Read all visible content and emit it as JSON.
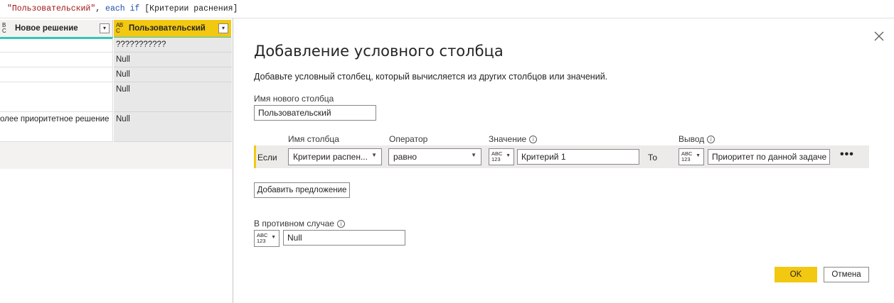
{
  "formula": {
    "str_part": "\"Пользовательский\"",
    "sep": ", ",
    "kw_each": "each",
    "space": " ",
    "kw_if": "if",
    "ref": " [Критерии раснения]"
  },
  "grid": {
    "columns": [
      {
        "type_top": "B",
        "type_bottom": "C",
        "type_prefix": "A",
        "label": "Новое решение"
      },
      {
        "type_top": "B",
        "type_bottom": "C",
        "type_prefix": "A",
        "label": "Пользовательский"
      }
    ],
    "rows": [
      {
        "c1": "",
        "c2": "???????????"
      },
      {
        "c1": "",
        "c2": "Null"
      },
      {
        "c1": "",
        "c2": "Null"
      },
      {
        "c1": "",
        "c2": "Null"
      },
      {
        "c1": "олее приоритетное решение",
        "c2": "Null"
      }
    ]
  },
  "dialog": {
    "title": "Добавление условного столбца",
    "subtitle": "Добавьте условный столбец, который вычисляется из других столбцов или значений.",
    "new_col_label": "Имя нового столбца",
    "new_col_value": "Пользовательский",
    "headers": {
      "column_name": "Имя столбца",
      "operator": "Оператор",
      "value": "Значение",
      "output": "Вывод"
    },
    "rule": {
      "if_label": "Если",
      "column": "Критерии распен...",
      "operator": "равно",
      "value_type": "ABC 123",
      "value": "Критерий 1",
      "then_label": "То",
      "output_type": "ABC 123",
      "output": "Приоритет по данной задаче",
      "more": "•••"
    },
    "add_clause": "Добавить предложение",
    "else_label": "В противном случае",
    "else_type": "ABC 123",
    "else_value": "Null",
    "ok": "OK",
    "cancel": "Отмена"
  },
  "colors": {
    "accent": "#f2c811",
    "header_underline": "#33c6b7"
  }
}
